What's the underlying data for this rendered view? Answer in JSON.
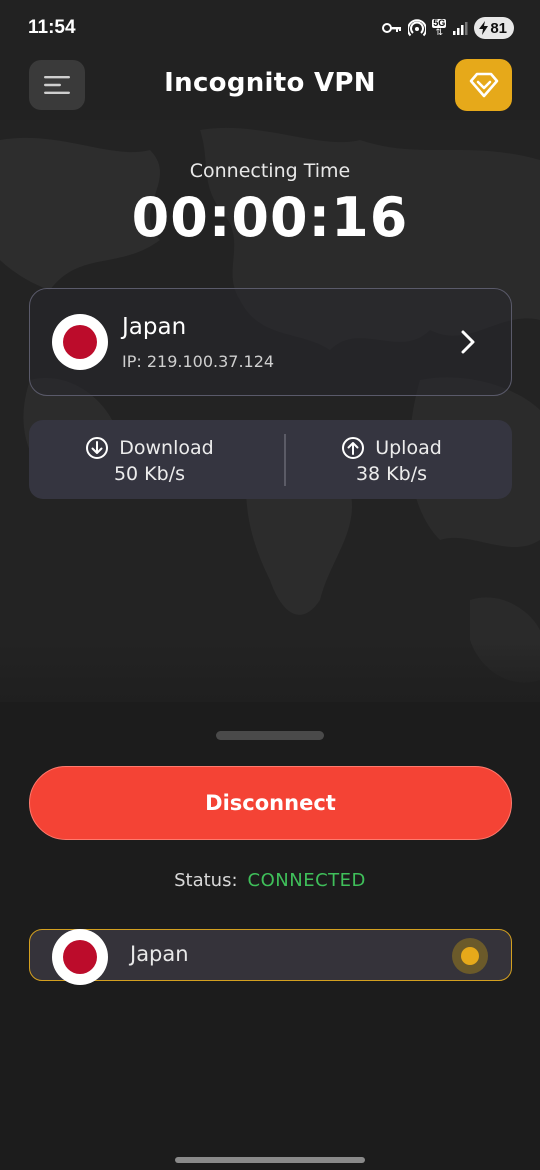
{
  "status_bar": {
    "time": "11:54",
    "network_badge": "5G",
    "battery_level": "81"
  },
  "header": {
    "title": "Incognito VPN",
    "menu_icon": "hamburger-menu-icon",
    "premium_icon": "diamond-icon"
  },
  "timer": {
    "label": "Connecting Time",
    "value": "00:00:16"
  },
  "server": {
    "country": "Japan",
    "ip": "IP: 219.100.37.124",
    "flag_icon": "japan-flag-icon"
  },
  "speed": {
    "download_label": "Download",
    "download_value": "50 Kb/s",
    "upload_label": "Upload",
    "upload_value": "38 Kb/s"
  },
  "sheet": {
    "disconnect_label": "Disconnect",
    "status_key": "Status:",
    "status_value": "CONNECTED",
    "selected_server": "Japan",
    "selected": true
  },
  "colors": {
    "background": "#1c1c1c",
    "accent_gold": "#e6a91a",
    "disconnect_red": "#f44335",
    "connected_green": "#3fbf5a",
    "japan_red": "#bc0c2b"
  }
}
